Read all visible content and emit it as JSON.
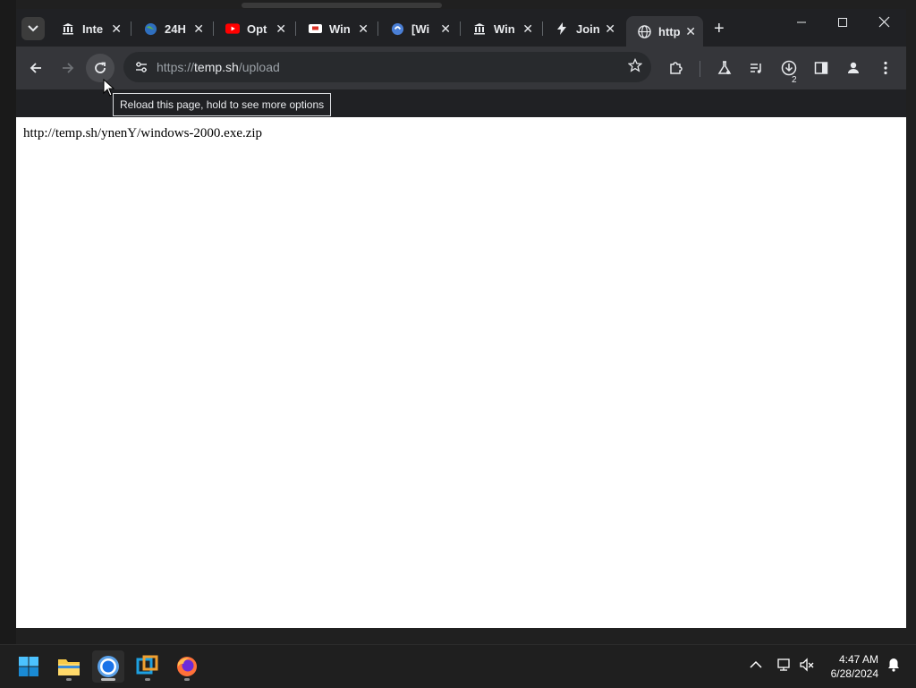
{
  "browser": {
    "tabs": [
      {
        "title": "Inte",
        "icon": "bank-icon"
      },
      {
        "title": "24H",
        "icon": "globe-icon"
      },
      {
        "title": "Opt",
        "icon": "youtube-icon"
      },
      {
        "title": "Win",
        "icon": "ticket-icon"
      },
      {
        "title": "[Wi",
        "icon": "blue-circle-icon"
      },
      {
        "title": "Win",
        "icon": "bank-icon"
      },
      {
        "title": "Join",
        "icon": "bolt-icon"
      },
      {
        "title": "http",
        "icon": "globe-icon",
        "active": true
      }
    ],
    "close_glyph": "✕",
    "new_tab_glyph": "+",
    "url_scheme": "https://",
    "url_host": "temp.sh",
    "url_path": "/upload",
    "downloads_count": "2",
    "tooltip": "Reload this page, hold to see more options"
  },
  "page": {
    "text": "http://temp.sh/ynenY/windows-2000.exe.zip"
  },
  "taskbar": {
    "time": "4:47 AM",
    "date": "6/28/2024"
  },
  "colors": {
    "tab_strip": "#202124",
    "toolbar": "#35363a",
    "omnibox": "#282a2d",
    "taskbar": "#1f1f1f"
  }
}
